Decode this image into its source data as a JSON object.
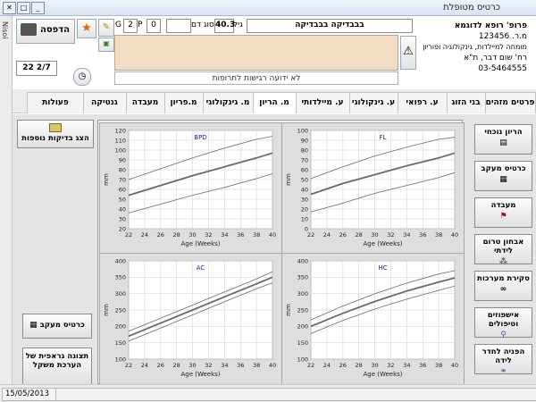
{
  "window": {
    "title": "כרטיס מטופלת"
  },
  "left_strip": {
    "label": "Nisoi"
  },
  "doctor": {
    "name": "פרופ' רופא לדוגמא",
    "license": "מ.ר. 123456",
    "specialty": "מומחה למיילדות, גינקולוגיה ופוריון",
    "address": "רח' שום דבר, ת\"א",
    "phone": "03-5464555"
  },
  "patient": {
    "name": "בבבדיקה בבבדיקה",
    "age_label": "גיל",
    "age": "40.3",
    "blood_label": "סוג דם",
    "blood_type": "",
    "g_label": "G",
    "g_value": "2",
    "p_label": "P",
    "p_value": "0"
  },
  "header": {
    "print_label": "הדפסה",
    "date_value": "22 2/7",
    "allergy_text": "לא ידועה רגישות לתרופות"
  },
  "tabs": [
    {
      "label": "פרטים מזהים",
      "active": false
    },
    {
      "label": "בני הזוג",
      "active": false
    },
    {
      "label": "ע. רפואי",
      "active": false
    },
    {
      "label": "ע. גינקולוגי",
      "active": false
    },
    {
      "label": "ע. מיילדותי",
      "active": false
    },
    {
      "label": "מ. הריון",
      "active": true
    },
    {
      "label": "מ. גינקולוגי",
      "active": false
    },
    {
      "label": "מ.פריון",
      "active": false
    },
    {
      "label": "מעבדה",
      "active": false
    },
    {
      "label": "גנטיקה",
      "active": false
    },
    {
      "label": "פעולות",
      "active": false
    }
  ],
  "side_buttons": [
    {
      "label": "הריון נוכחי",
      "icon": "document-icon"
    },
    {
      "label": "כרטיס מעקב",
      "icon": "grid-icon"
    },
    {
      "label": "מעבדה",
      "icon": "flag-icon"
    },
    {
      "label": "אבחון טרום לידתי",
      "icon": "molecule-icon"
    },
    {
      "label": "סקירת מערכות",
      "icon": "glasses-icon"
    },
    {
      "label": "אישפוזים וטיפולים",
      "icon": "magnifier-icon"
    },
    {
      "label": "הפניה לחדר לידה",
      "icon": "link-icon"
    }
  ],
  "left_buttons": {
    "show_more_tests": "הצג בדיקות נוספות",
    "tracking_card": "כרטיס מעקב",
    "weight_graph": "תצוגה גראפית של הערכת משקל"
  },
  "chart_data": [
    {
      "type": "line",
      "title": "BPD",
      "xlabel": "Age (Weeks)",
      "ylabel": "mm",
      "xlim": [
        22,
        40
      ],
      "ylim": [
        20,
        120
      ],
      "x_ticks": [
        22,
        24,
        26,
        28,
        30,
        32,
        34,
        36,
        38,
        40
      ],
      "y_ticks": [
        20,
        30,
        40,
        50,
        60,
        70,
        80,
        90,
        100,
        110,
        120
      ],
      "grid": true,
      "series": [
        {
          "role": "upper",
          "x": [
            22,
            26,
            30,
            34,
            38,
            40
          ],
          "values": [
            70,
            81,
            92,
            102,
            111,
            114
          ]
        },
        {
          "role": "median",
          "x": [
            22,
            26,
            30,
            34,
            38,
            40
          ],
          "values": [
            54,
            64,
            74,
            83,
            92,
            97
          ]
        },
        {
          "role": "lower",
          "x": [
            22,
            26,
            30,
            34,
            38,
            40
          ],
          "values": [
            36,
            45,
            54,
            62,
            71,
            76
          ]
        }
      ]
    },
    {
      "type": "line",
      "title": "FL",
      "xlabel": "Age (Weeks)",
      "ylabel": "mm",
      "xlim": [
        22,
        40
      ],
      "ylim": [
        0,
        100
      ],
      "x_ticks": [
        22,
        24,
        26,
        28,
        30,
        32,
        34,
        36,
        38,
        40
      ],
      "y_ticks": [
        0,
        10,
        20,
        30,
        40,
        50,
        60,
        70,
        80,
        90,
        100
      ],
      "grid": true,
      "series": [
        {
          "role": "upper",
          "x": [
            22,
            26,
            30,
            34,
            38,
            40
          ],
          "values": [
            51,
            63,
            74,
            83,
            91,
            93
          ]
        },
        {
          "role": "median",
          "x": [
            22,
            26,
            30,
            34,
            38,
            40
          ],
          "values": [
            35,
            46,
            55,
            64,
            72,
            77
          ]
        },
        {
          "role": "lower",
          "x": [
            22,
            26,
            30,
            34,
            38,
            40
          ],
          "values": [
            17,
            26,
            36,
            44,
            52,
            57
          ]
        }
      ]
    },
    {
      "type": "line",
      "title": "AC",
      "xlabel": "Age (Weeks)",
      "ylabel": "mm",
      "xlim": [
        22,
        40
      ],
      "ylim": [
        100,
        400
      ],
      "x_ticks": [
        22,
        24,
        26,
        28,
        30,
        32,
        34,
        36,
        38,
        40
      ],
      "y_ticks": [
        100,
        150,
        200,
        250,
        300,
        350,
        400
      ],
      "grid": true,
      "series": [
        {
          "role": "upper",
          "x": [
            22,
            26,
            30,
            34,
            38,
            40
          ],
          "values": [
            185,
            225,
            265,
            305,
            345,
            367
          ]
        },
        {
          "role": "median",
          "x": [
            22,
            26,
            30,
            34,
            38,
            40
          ],
          "values": [
            170,
            210,
            250,
            290,
            330,
            350
          ]
        },
        {
          "role": "lower",
          "x": [
            22,
            26,
            30,
            34,
            38,
            40
          ],
          "values": [
            155,
            195,
            235,
            275,
            315,
            333
          ]
        }
      ]
    },
    {
      "type": "line",
      "title": "HC",
      "xlabel": "Age (Weeks)",
      "ylabel": "mm",
      "xlim": [
        22,
        40
      ],
      "ylim": [
        100,
        400
      ],
      "x_ticks": [
        22,
        24,
        26,
        28,
        30,
        32,
        34,
        36,
        38,
        40
      ],
      "y_ticks": [
        100,
        150,
        200,
        250,
        300,
        350,
        400
      ],
      "grid": true,
      "series": [
        {
          "role": "upper",
          "x": [
            22,
            26,
            30,
            34,
            38,
            40
          ],
          "values": [
            220,
            262,
            300,
            332,
            360,
            370
          ]
        },
        {
          "role": "median",
          "x": [
            22,
            26,
            30,
            34,
            38,
            40
          ],
          "values": [
            200,
            240,
            276,
            308,
            335,
            348
          ]
        },
        {
          "role": "lower",
          "x": [
            22,
            26,
            30,
            34,
            38,
            40
          ],
          "values": [
            178,
            218,
            253,
            283,
            310,
            323
          ]
        }
      ]
    }
  ],
  "status": {
    "date": "15/05/2013"
  },
  "colors": {
    "notes_bg": "#f2dcc4",
    "chart_title": "#1a1aa8",
    "series_line": "#6a6a6a"
  }
}
